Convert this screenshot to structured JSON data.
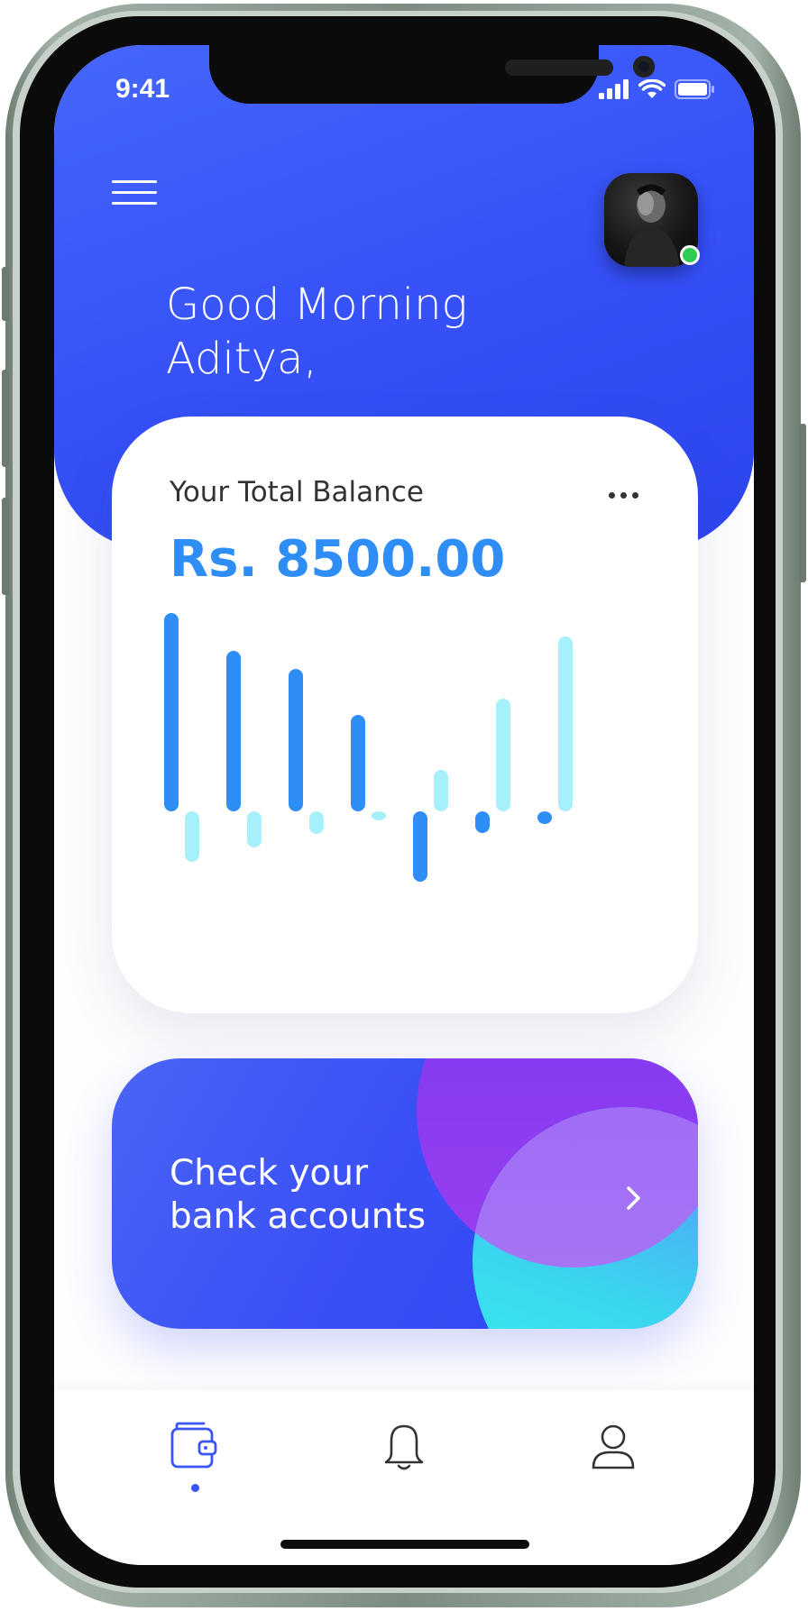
{
  "status_bar": {
    "time": "9:41"
  },
  "header": {
    "greeting_line1": "Good Morning",
    "greeting_line2": "Aditya,",
    "user_online": true
  },
  "balance_card": {
    "label": "Your Total Balance",
    "amount": "Rs. 8500.00"
  },
  "chart_data": {
    "type": "bar",
    "categories": [
      "",
      "",
      "",
      "",
      "",
      "",
      ""
    ],
    "series": [
      {
        "color": "#2f8ef5",
        "values": [
          220,
          178,
          158,
          107,
          -78,
          -24,
          -14
        ]
      },
      {
        "color": "#a6f0fb",
        "values": [
          -56,
          -40,
          -25,
          -10,
          46,
          125,
          194
        ]
      }
    ],
    "grid": false,
    "axes_visible": false
  },
  "bank_card": {
    "line1": "Check your",
    "line2": "bank accounts",
    "colors": {
      "base": "#3a50f6",
      "purple_circle": "#8a3cf0",
      "cyan_circle": "#37f2ee"
    }
  },
  "bottom_nav": {
    "items": [
      {
        "icon": "wallet-icon",
        "active": true
      },
      {
        "icon": "bell-icon",
        "active": false
      },
      {
        "icon": "user-icon",
        "active": false
      }
    ]
  },
  "colors": {
    "primary": "#3550f7",
    "balance_text": "#2f8ef5",
    "online": "#2ecc52"
  }
}
